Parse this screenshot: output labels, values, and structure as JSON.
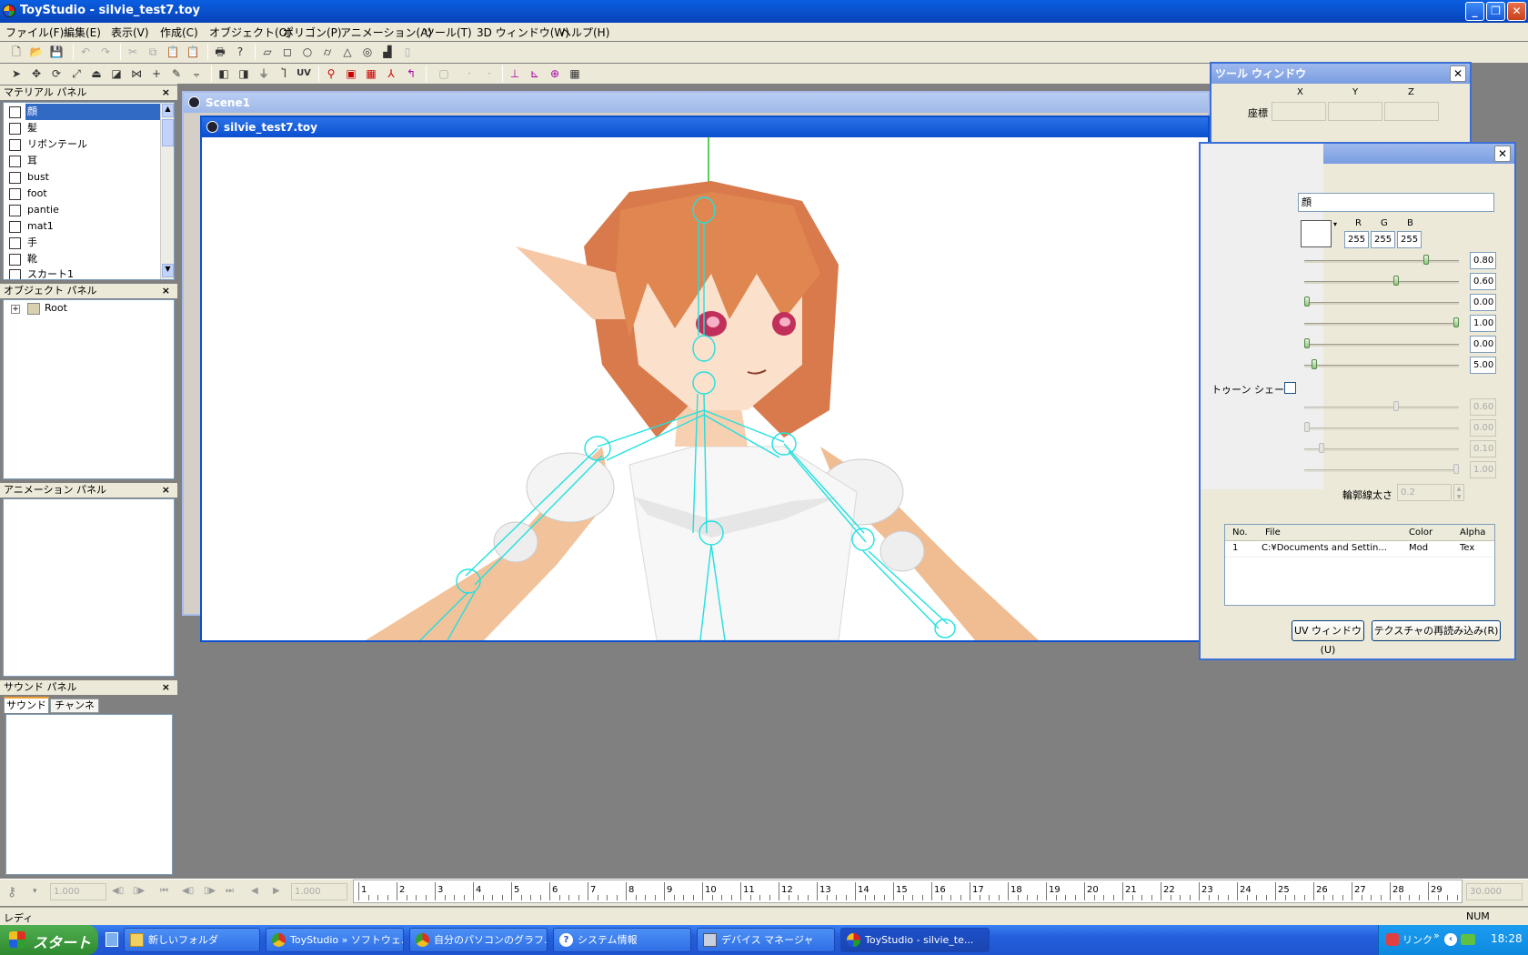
{
  "window": {
    "title": "ToyStudio - silvie_test7.toy",
    "minimize": "_",
    "restore": "❐",
    "close": "✕"
  },
  "menu": [
    "ファイル(F)",
    "編集(E)",
    "表示(V)",
    "作成(C)",
    "オブジェクト(O)",
    "ポリゴン(P)",
    "アニメーション(A)",
    "ツール(T)",
    "3D ウィンドウ(W)",
    "ヘルプ(H)"
  ],
  "toolbar2": {
    "uv_label": "UV"
  },
  "panels": {
    "material": {
      "title": "マテリアル パネル",
      "close": "×",
      "items": [
        "顔",
        "髪",
        "リボンテール",
        "耳",
        "bust",
        "foot",
        "pantie",
        "mat1",
        "手",
        "靴",
        "スカート1"
      ]
    },
    "object": {
      "title": "オブジェクト パネル",
      "close": "×",
      "tree_root": "Root",
      "expander": "+"
    },
    "animation": {
      "title": "アニメーション パネル",
      "close": "×"
    },
    "sound": {
      "title": "サウンド パネル",
      "close": "×",
      "tabs": [
        "サウンド",
        "チャンネル"
      ]
    }
  },
  "documents": {
    "scene_title": "Scene1",
    "doc_title": "silvie_test7.toy"
  },
  "tool_window": {
    "title": "ツール ウィンドウ",
    "close": "✕",
    "axes": [
      "X",
      "Y",
      "Z"
    ],
    "coord_label": "座標"
  },
  "material_window": {
    "close": "✕",
    "name_value": "顔",
    "rgb_labels": [
      "R",
      "G",
      "B"
    ],
    "rgb_values": [
      "255",
      "255",
      "255"
    ],
    "sliders": [
      {
        "value": "0.80",
        "level": 0.8,
        "enabled": true
      },
      {
        "value": "0.60",
        "level": 0.6,
        "enabled": true
      },
      {
        "value": "0.00",
        "level": 0.0,
        "enabled": true
      },
      {
        "value": "1.00",
        "level": 1.0,
        "enabled": true
      },
      {
        "value": "0.00",
        "level": 0.0,
        "enabled": true
      },
      {
        "value": "5.00",
        "level": 0.05,
        "enabled": true
      }
    ],
    "toon_label": "トゥーン シェーダ",
    "toon_sliders": [
      {
        "value": "0.60",
        "level": 0.6
      },
      {
        "value": "0.00",
        "level": 0.0
      },
      {
        "value": "0.10",
        "level": 0.1
      },
      {
        "value": "1.00",
        "level": 1.0
      }
    ],
    "outline_label": "輪郭線太さ",
    "outline_value": "0.2",
    "texture_table": {
      "headers": [
        "No.",
        "File",
        "Color",
        "Alpha"
      ],
      "rows": [
        [
          "1",
          "C:¥Documents and Settin...",
          "Mod",
          "Tex"
        ]
      ]
    },
    "uv_button": "UV ウィンドウ(U)",
    "reload_button": "テクスチャの再読み込み(R)"
  },
  "timeline": {
    "field1": "1.000",
    "field2": "1.000",
    "end_field": "30.000",
    "ticks": [
      "1",
      "2",
      "3",
      "4",
      "5",
      "6",
      "7",
      "8",
      "9",
      "10",
      "11",
      "12",
      "13",
      "14",
      "15",
      "16",
      "17",
      "18",
      "19",
      "20",
      "21",
      "22",
      "23",
      "24",
      "25",
      "26",
      "27",
      "28",
      "29"
    ]
  },
  "status": {
    "text": "レディ",
    "num": "NUM"
  },
  "taskbar": {
    "start": "スタート",
    "tasks": [
      "新しいフォルダ",
      "ToyStudio » ソフトウェ...",
      "自分のパソコンのグラフ...",
      "システム情報",
      "デバイス マネージャ",
      "ToyStudio - silvie_te..."
    ],
    "tray_link": "リンク",
    "tray_more": "»",
    "clock": "18:28"
  }
}
